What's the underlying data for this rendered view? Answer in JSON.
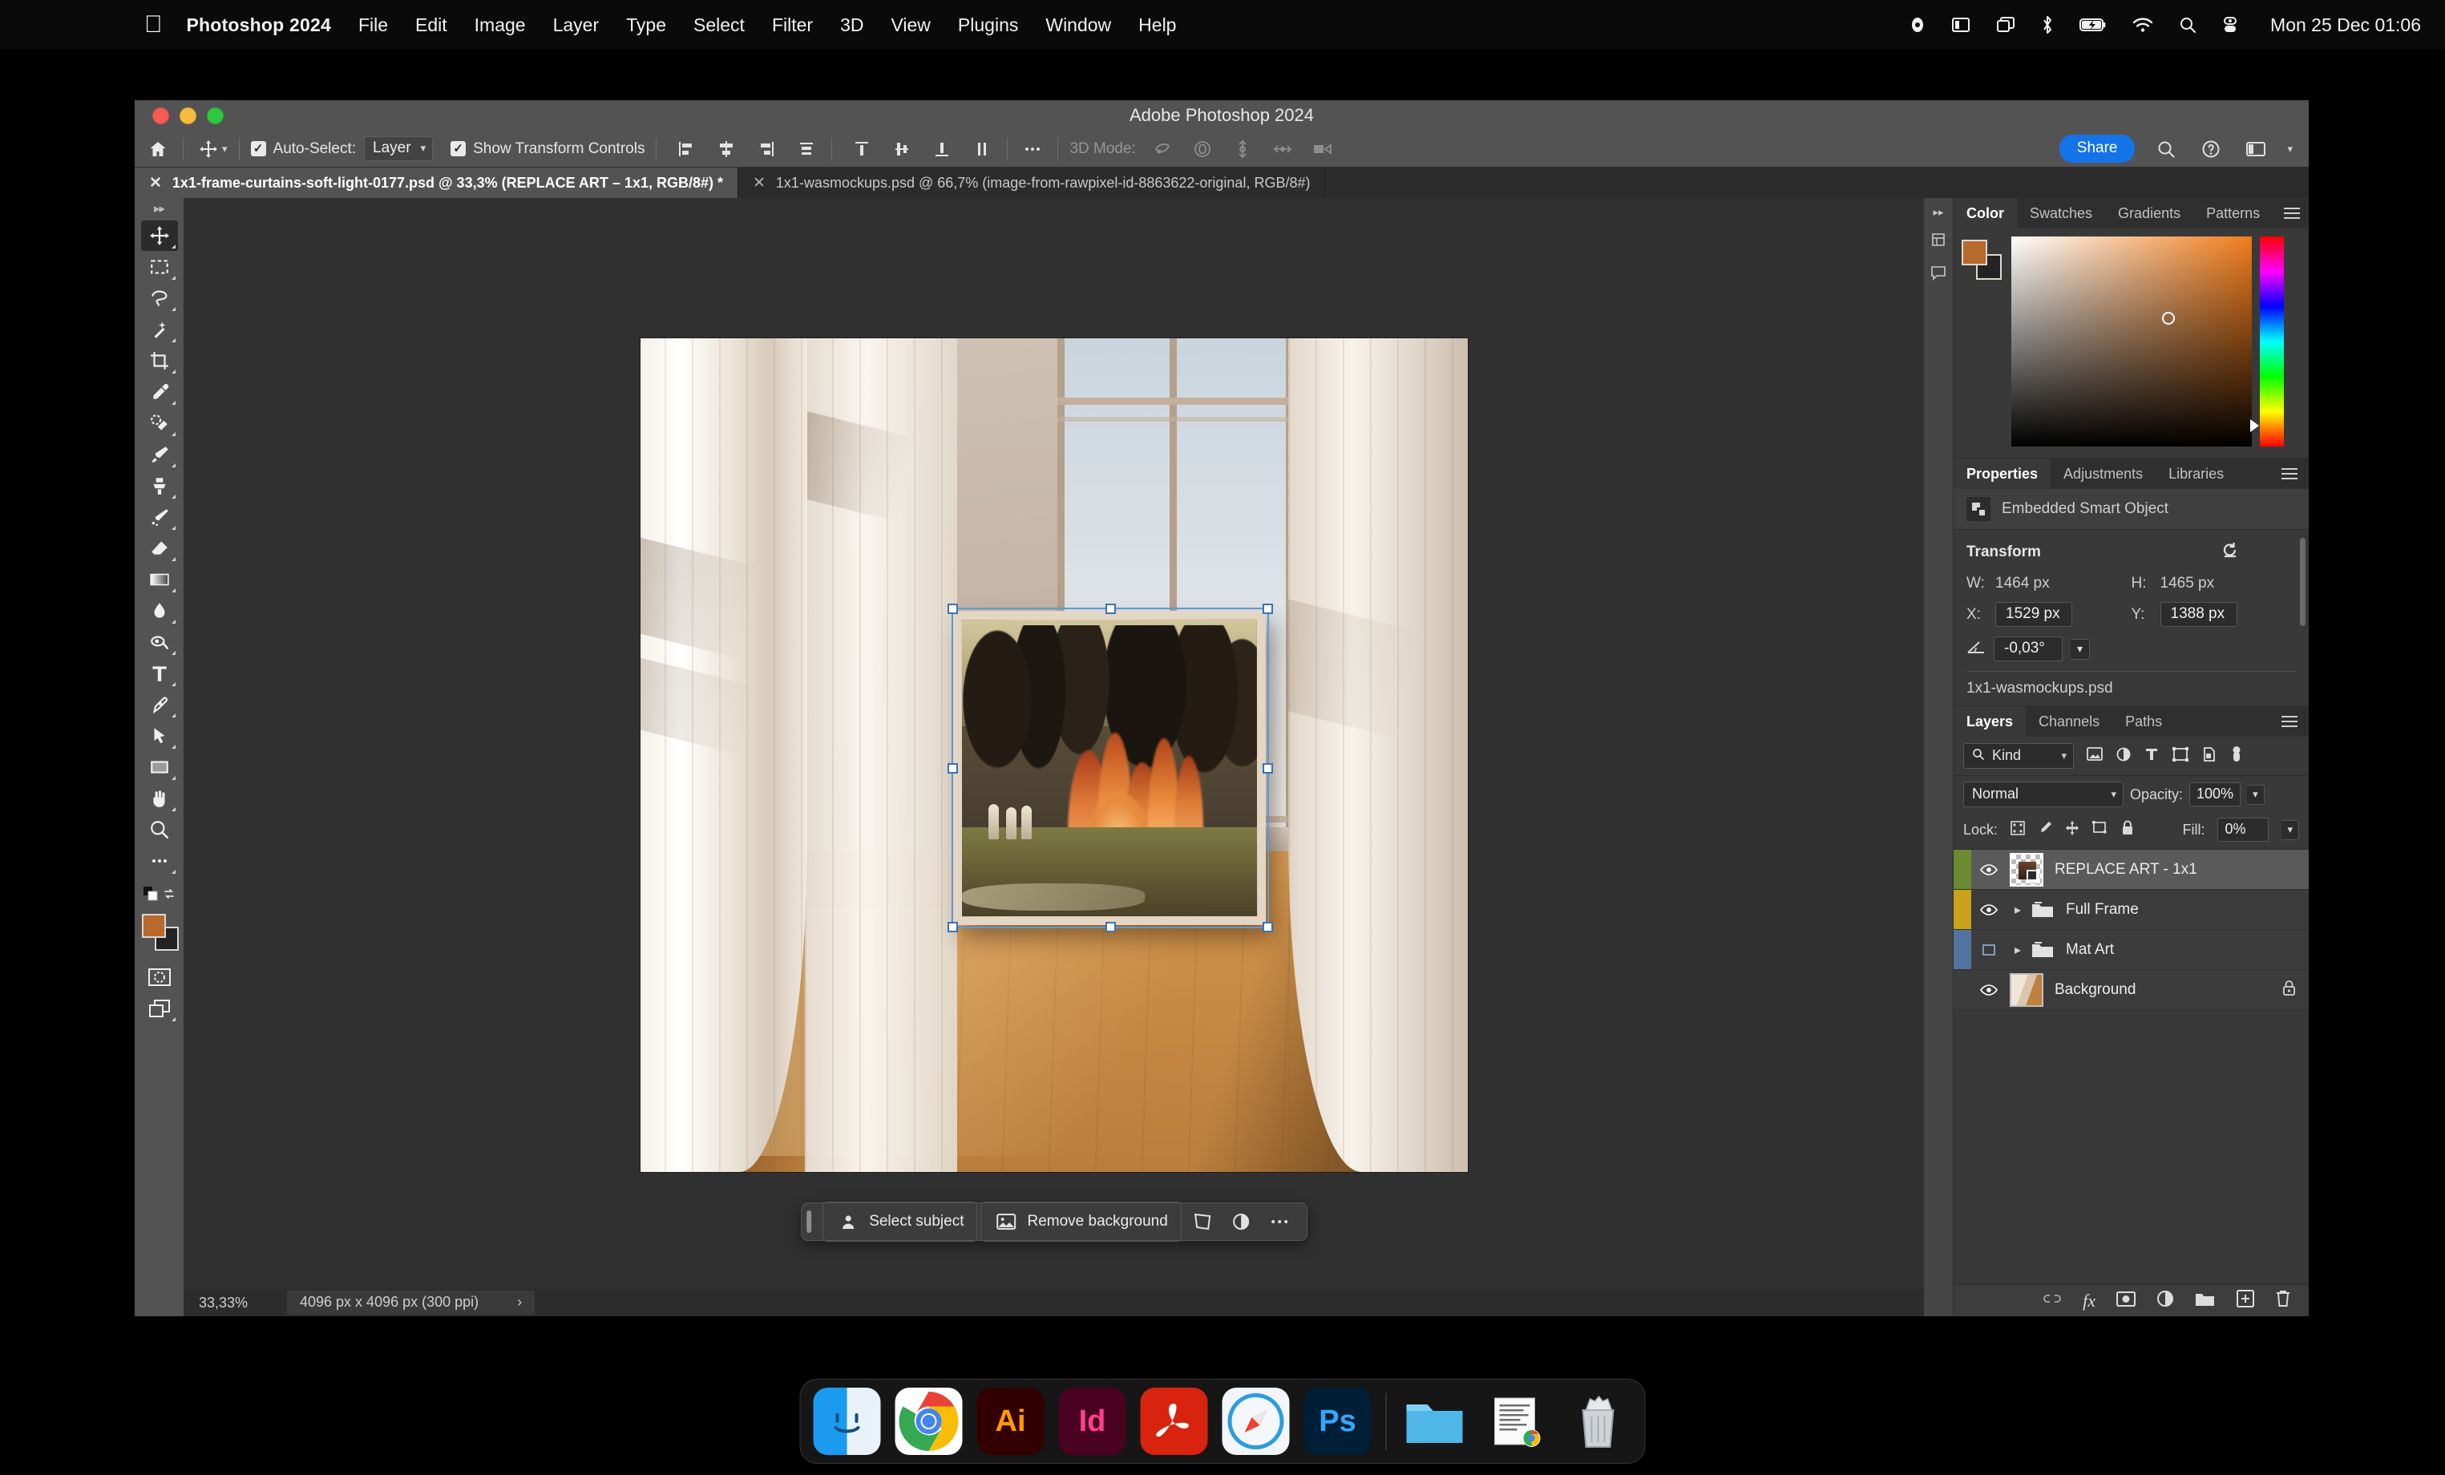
{
  "menubar": {
    "apple_icon": "apple-logo-icon",
    "app_name": "Photoshop 2024",
    "items": [
      "File",
      "Edit",
      "Image",
      "Layer",
      "Type",
      "Select",
      "Filter",
      "3D",
      "View",
      "Plugins",
      "Window",
      "Help"
    ],
    "status_icons": [
      "record-icon",
      "display-icon",
      "screen-mirroring-icon",
      "bluetooth-icon",
      "battery-charging-icon",
      "wifi-icon",
      "spotlight-search-icon",
      "control-center-icon"
    ],
    "clock": "Mon 25 Dec 01:06"
  },
  "window": {
    "title": "Adobe Photoshop 2024"
  },
  "options_bar": {
    "home_icon": "home-icon",
    "tool_icon": "move-tool-icon",
    "auto_select_checked": "✓",
    "auto_select_label": "Auto-Select:",
    "auto_select_value": "Layer",
    "show_transform_checked": "✓",
    "show_transform_label": "Show Transform Controls",
    "align_icons": [
      "align-left-edges-icon",
      "align-horizontal-centers-icon",
      "align-right-edges-icon",
      "align-top-edges-icon",
      "distribute-top-icon",
      "distribute-vertical-centers-icon",
      "distribute-bottom-icon",
      "distribute-left-icon"
    ],
    "more_icon": "more-options-icon",
    "mode_3d_label": "3D Mode:",
    "mode_3d_icons": [
      "rotate-3d-icon",
      "roll-3d-icon",
      "drag-3d-icon",
      "slide-3d-icon",
      "scale-3d-icon"
    ],
    "share_label": "Share",
    "search_icon": "search-icon",
    "help_icon": "help-icon",
    "workspace_icon": "workspace-switcher-icon"
  },
  "tabs": [
    {
      "label": "1x1-frame-curtains-soft-light-0177.psd @ 33,3% (REPLACE ART – 1x1, RGB/8#) *",
      "active": true
    },
    {
      "label": "1x1-wasmockups.psd @ 66,7% (image-from-rawpixel-id-8863622-original, RGB/8#)",
      "active": false
    }
  ],
  "toolbar": {
    "tools": [
      {
        "name": "move-tool",
        "active": true
      },
      {
        "name": "rectangular-marquee-tool",
        "active": false
      },
      {
        "name": "lasso-tool",
        "active": false
      },
      {
        "name": "magic-wand-tool",
        "active": false
      },
      {
        "name": "crop-tool",
        "active": false
      },
      {
        "name": "eyedropper-tool",
        "active": false
      },
      {
        "name": "spot-healing-brush-tool",
        "active": false
      },
      {
        "name": "brush-tool",
        "active": false
      },
      {
        "name": "clone-stamp-tool",
        "active": false
      },
      {
        "name": "history-brush-tool",
        "active": false
      },
      {
        "name": "eraser-tool",
        "active": false
      },
      {
        "name": "gradient-tool",
        "active": false
      },
      {
        "name": "blur-tool",
        "active": false
      },
      {
        "name": "dodge-tool",
        "active": false
      },
      {
        "name": "type-tool",
        "active": false
      },
      {
        "name": "pen-tool",
        "active": false
      },
      {
        "name": "path-selection-tool",
        "active": false
      },
      {
        "name": "rectangle-tool",
        "active": false
      },
      {
        "name": "hand-tool",
        "active": false
      },
      {
        "name": "zoom-tool",
        "active": false
      },
      {
        "name": "edit-toolbar",
        "active": false
      }
    ],
    "foreground_color": "#b8692c",
    "background_color": "#232323",
    "quick_mask_icon": "quick-mask-icon",
    "screen_mode_icon": "screen-mode-icon"
  },
  "canvas": {
    "artwork_description": "Interior room mockup with white curtains, wooden parquet floor and a framed painting of a forest fire",
    "selection_handles": 8
  },
  "contextual_bar": {
    "select_subject_label": "Select subject",
    "remove_background_label": "Remove background",
    "transform_icon": "transform-icon",
    "adjustment_icon": "adjustment-icon",
    "more_icon": "more-options-icon"
  },
  "statusbar": {
    "zoom": "33,33%",
    "doc_size": "4096 px x 4096 px (300 ppi)",
    "chevron": "›"
  },
  "color_panel": {
    "tabs": [
      "Color",
      "Swatches",
      "Gradients",
      "Patterns"
    ],
    "active_tab": "Color",
    "foreground_color": "#b8692c",
    "background_color": "#232323",
    "picker_hue": "#f07c1b"
  },
  "properties_panel": {
    "tabs": [
      "Properties",
      "Adjustments",
      "Libraries"
    ],
    "active_tab": "Properties",
    "object_type": "Embedded Smart Object",
    "section_title": "Transform",
    "reset_icon": "reset-transform-icon",
    "w_label": "W:",
    "w_value": "1464 px",
    "h_label": "H:",
    "h_value": "1465 px",
    "x_label": "X:",
    "x_value": "1529 px",
    "y_label": "Y:",
    "y_value": "1388 px",
    "angle_icon": "angle-icon",
    "angle_value": "-0,03°",
    "file_name": "1x1-wasmockups.psd"
  },
  "layers_panel": {
    "tabs": [
      "Layers",
      "Channels",
      "Paths"
    ],
    "active_tab": "Layers",
    "filter_label": "Kind",
    "filter_icons": [
      "filter-pixel-icon",
      "filter-adjustment-icon",
      "filter-type-icon",
      "filter-shape-icon",
      "filter-smart-object-icon",
      "filter-toggle-icon"
    ],
    "blend_mode": "Normal",
    "opacity_label": "Opacity:",
    "opacity_value": "100%",
    "lock_label": "Lock:",
    "lock_icons": [
      "lock-transparent-pixels-icon",
      "lock-image-pixels-icon",
      "lock-position-icon",
      "lock-artboard-nesting-icon",
      "lock-all-icon"
    ],
    "fill_label": "Fill:",
    "fill_value": "0%",
    "layers": [
      {
        "name": "REPLACE ART - 1x1",
        "tag_color": "#6a8b30",
        "visible": true,
        "selected": true,
        "type": "smart-object",
        "locked": false,
        "expandable": false
      },
      {
        "name": "Full Frame",
        "tag_color": "#c9a21a",
        "visible": true,
        "selected": false,
        "type": "group",
        "locked": false,
        "expandable": true
      },
      {
        "name": "Mat Art",
        "tag_color": "#52739e",
        "visible": false,
        "selected": false,
        "type": "group",
        "locked": false,
        "expandable": true
      },
      {
        "name": "Background",
        "tag_color": "transparent",
        "visible": true,
        "selected": false,
        "type": "image",
        "locked": true,
        "expandable": false
      }
    ],
    "footer_icons": [
      "link-layers-icon",
      "add-layer-style-icon",
      "add-layer-mask-icon",
      "new-fill-adjustment-icon",
      "new-group-icon",
      "new-layer-icon",
      "delete-layer-icon"
    ]
  },
  "dock": {
    "items": [
      {
        "name": "finder",
        "label": "",
        "color": "#1a9bf0",
        "running": true
      },
      {
        "name": "google-chrome",
        "label": "",
        "color": "#ffffff",
        "running": true
      },
      {
        "name": "adobe-illustrator",
        "label": "Ai",
        "color": "#330000",
        "running": true
      },
      {
        "name": "adobe-indesign",
        "label": "Id",
        "color": "#49021f",
        "running": true
      },
      {
        "name": "adobe-acrobat",
        "label": "",
        "color": "#d8230f",
        "running": true
      },
      {
        "name": "safari",
        "label": "",
        "color": "#ffffff",
        "running": true
      },
      {
        "name": "adobe-photoshop",
        "label": "Ps",
        "color": "#001e36",
        "running": true
      },
      {
        "name": "downloads-folder",
        "label": "",
        "color": "#4fb7e8",
        "running": false
      },
      {
        "name": "document-stack",
        "label": "",
        "color": "#ffffff",
        "running": false
      },
      {
        "name": "trash",
        "label": "",
        "color": "#b9bcc0",
        "running": false
      }
    ]
  }
}
